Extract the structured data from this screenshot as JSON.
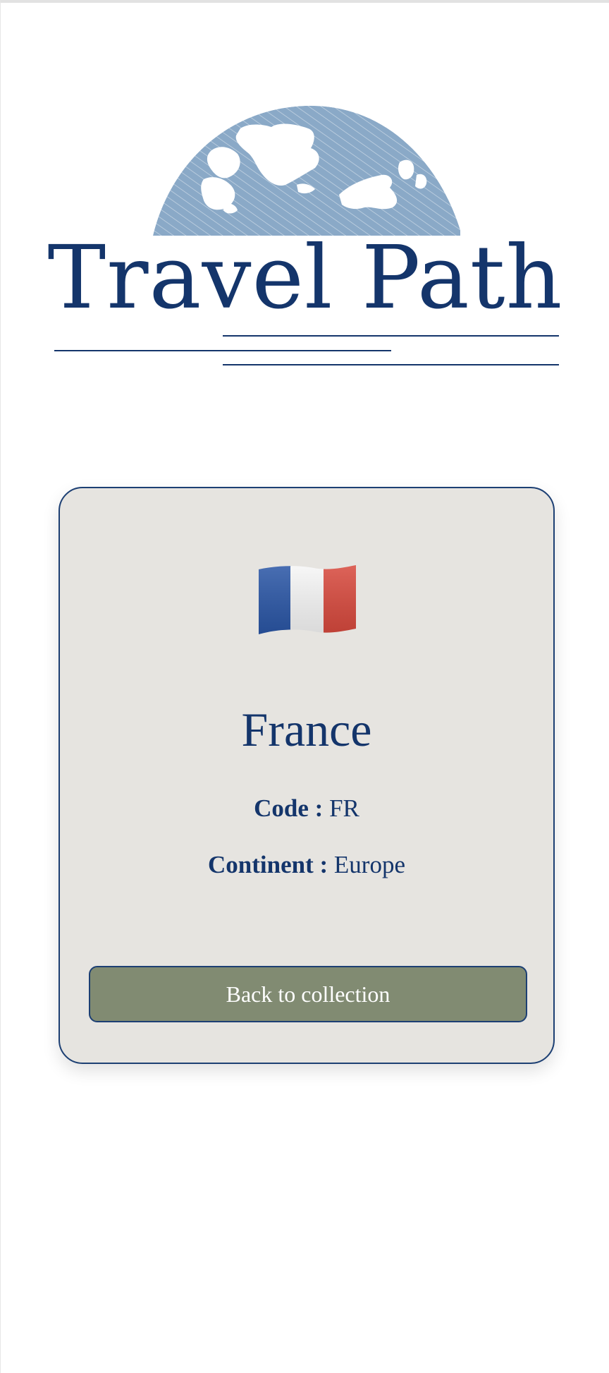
{
  "brand": {
    "title": "Travel Path",
    "logo_icon": "globe-icon"
  },
  "country": {
    "flag_icon": "france-flag-icon",
    "name": "France",
    "code_label": "Code :",
    "code": "FR",
    "continent_label": "Continent :",
    "continent": "Europe"
  },
  "actions": {
    "back_label": "Back to collection"
  },
  "colors": {
    "brand_navy": "#14356b",
    "globe_blue": "#8aa9c7",
    "card_bg": "#e6e4e0",
    "button_bg": "#818b72",
    "flag_blue": "#2a56a6",
    "flag_red": "#d8493d"
  }
}
